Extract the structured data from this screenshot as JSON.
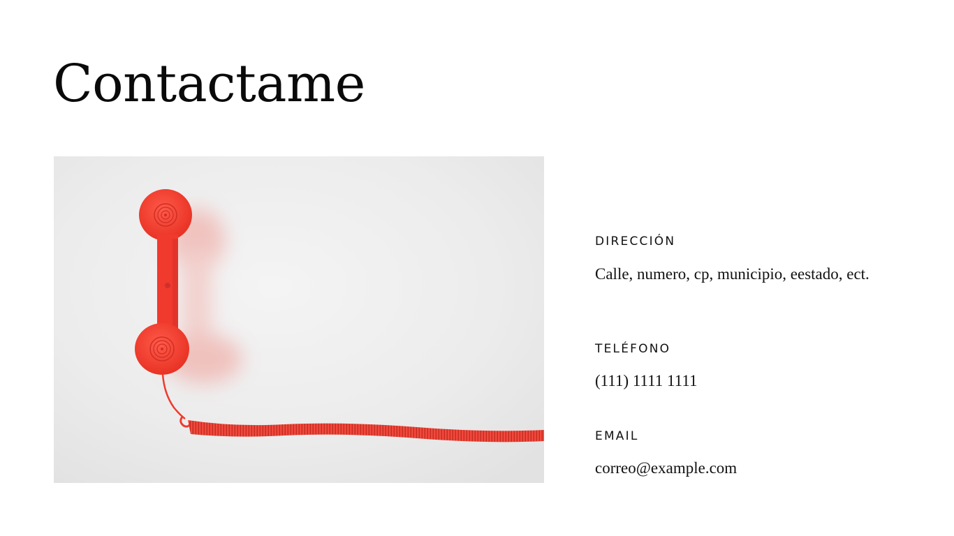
{
  "page": {
    "title": "Contactame"
  },
  "contact": {
    "address_label": "DIRECCIÓN",
    "address_value": "Calle, numero, cp, municipio, eestado, ect.",
    "phone_label": "TELÉFONO",
    "phone_value": "(111) 1111 1111",
    "email_label": "EMAIL",
    "email_value": "correo@example.com"
  },
  "photo": {
    "subject": "red-telephone-handset",
    "colors": {
      "background": "#ebebeb",
      "handset": "#f23b2f"
    }
  }
}
